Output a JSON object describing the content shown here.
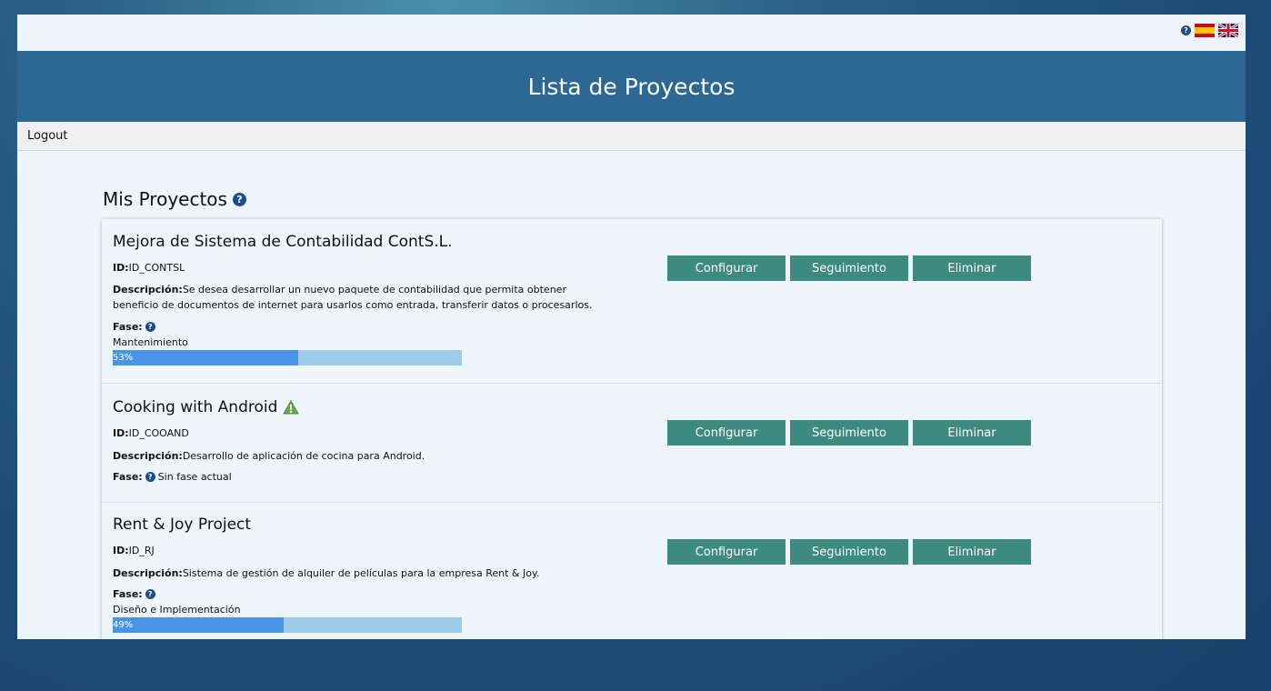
{
  "header": {
    "title": "Lista de Proyectos"
  },
  "nav": {
    "logout": "Logout"
  },
  "section": {
    "title": "Mis Proyectos"
  },
  "labels": {
    "id": "ID:",
    "description": "Descripción:",
    "phase": "Fase:"
  },
  "buttons": {
    "configure": "Configurar",
    "tracking": "Seguimiento",
    "delete": "Eliminar"
  },
  "projects": [
    {
      "name": "Mejora de Sistema de Contabilidad ContS.L.",
      "id": "ID_CONTSL",
      "description": "Se desea desarrollar un nuevo paquete de contabilidad que permita obtener beneficio de documentos de internet para usarlos como entrada, transferir datos o procesarlos.",
      "phase": "Mantenimiento",
      "progress_label": "53%",
      "progress": 0.53
    },
    {
      "name": "Cooking with Android",
      "id": "ID_COOAND",
      "description": "Desarrollo de aplicación de cocina para Android.",
      "phase_status": "Sin fase actual",
      "warning": "warning-icon"
    },
    {
      "name": "Rent & Joy Project",
      "id": "ID_RJ",
      "description": "Sistema de gestión de alquiler de películas para la empresa Rent & Joy.",
      "phase": "Diseño e Implementación",
      "progress_label": "49%",
      "progress": 0.49
    }
  ],
  "colors": {
    "header": "#2d6794",
    "button": "#3d8b80",
    "progress_fill": "#4a94e8",
    "progress_track": "#9ccce9"
  }
}
